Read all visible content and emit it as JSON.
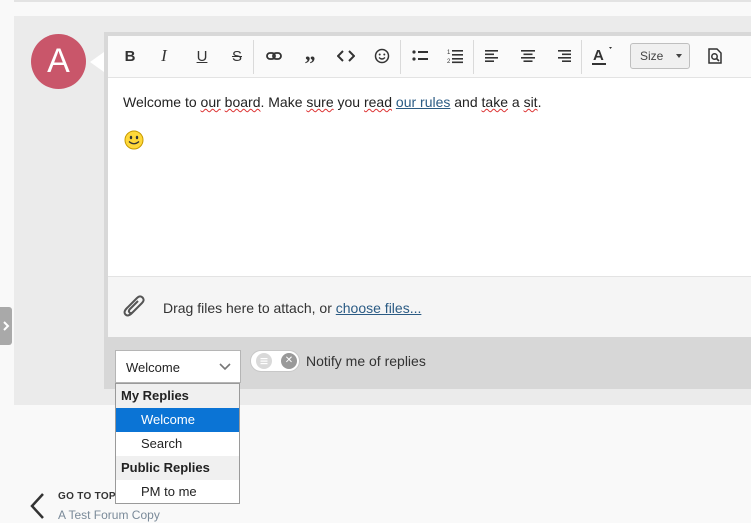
{
  "avatar": {
    "letter": "A",
    "color": "#c9566a"
  },
  "toolbar": {
    "size_label": "Size",
    "icons": [
      "bold-icon",
      "italic-icon",
      "underline-icon",
      "strikethrough-icon",
      "link-icon",
      "quote-icon",
      "code-icon",
      "emoji-icon",
      "bulleted-list-icon",
      "numbered-list-icon",
      "align-left-icon",
      "align-center-icon",
      "align-right-icon",
      "text-color-icon",
      "preview-icon"
    ]
  },
  "editor": {
    "text_parts": {
      "p1": "Welcome to ",
      "p2": "our",
      "p3": " ",
      "p4": "board",
      "p5": ". Make ",
      "p6": "sure",
      "p7": " you ",
      "p8": "read",
      "p9": " ",
      "link": "our rules",
      "p10": " and ",
      "p11": "take",
      "p12": " a ",
      "p13": "sit",
      "p14": "."
    },
    "emoji": "smiley-emoji"
  },
  "attach": {
    "text": "Drag files here to attach, or ",
    "link": "choose files..."
  },
  "reply_select": {
    "value": "Welcome"
  },
  "notify": {
    "label": "Notify me of replies",
    "enabled": false
  },
  "dropdown": {
    "groups": [
      {
        "label": "My Replies",
        "options": [
          "Welcome",
          "Search"
        ]
      },
      {
        "label": "Public Replies",
        "options": [
          "PM to me"
        ]
      }
    ],
    "selected": "Welcome"
  },
  "footer": {
    "go_to_top": "GO TO TOP",
    "forum_name": "A Test Forum Copy"
  },
  "colors": {
    "accent": "#0b74d5",
    "link": "#2b5b84"
  }
}
